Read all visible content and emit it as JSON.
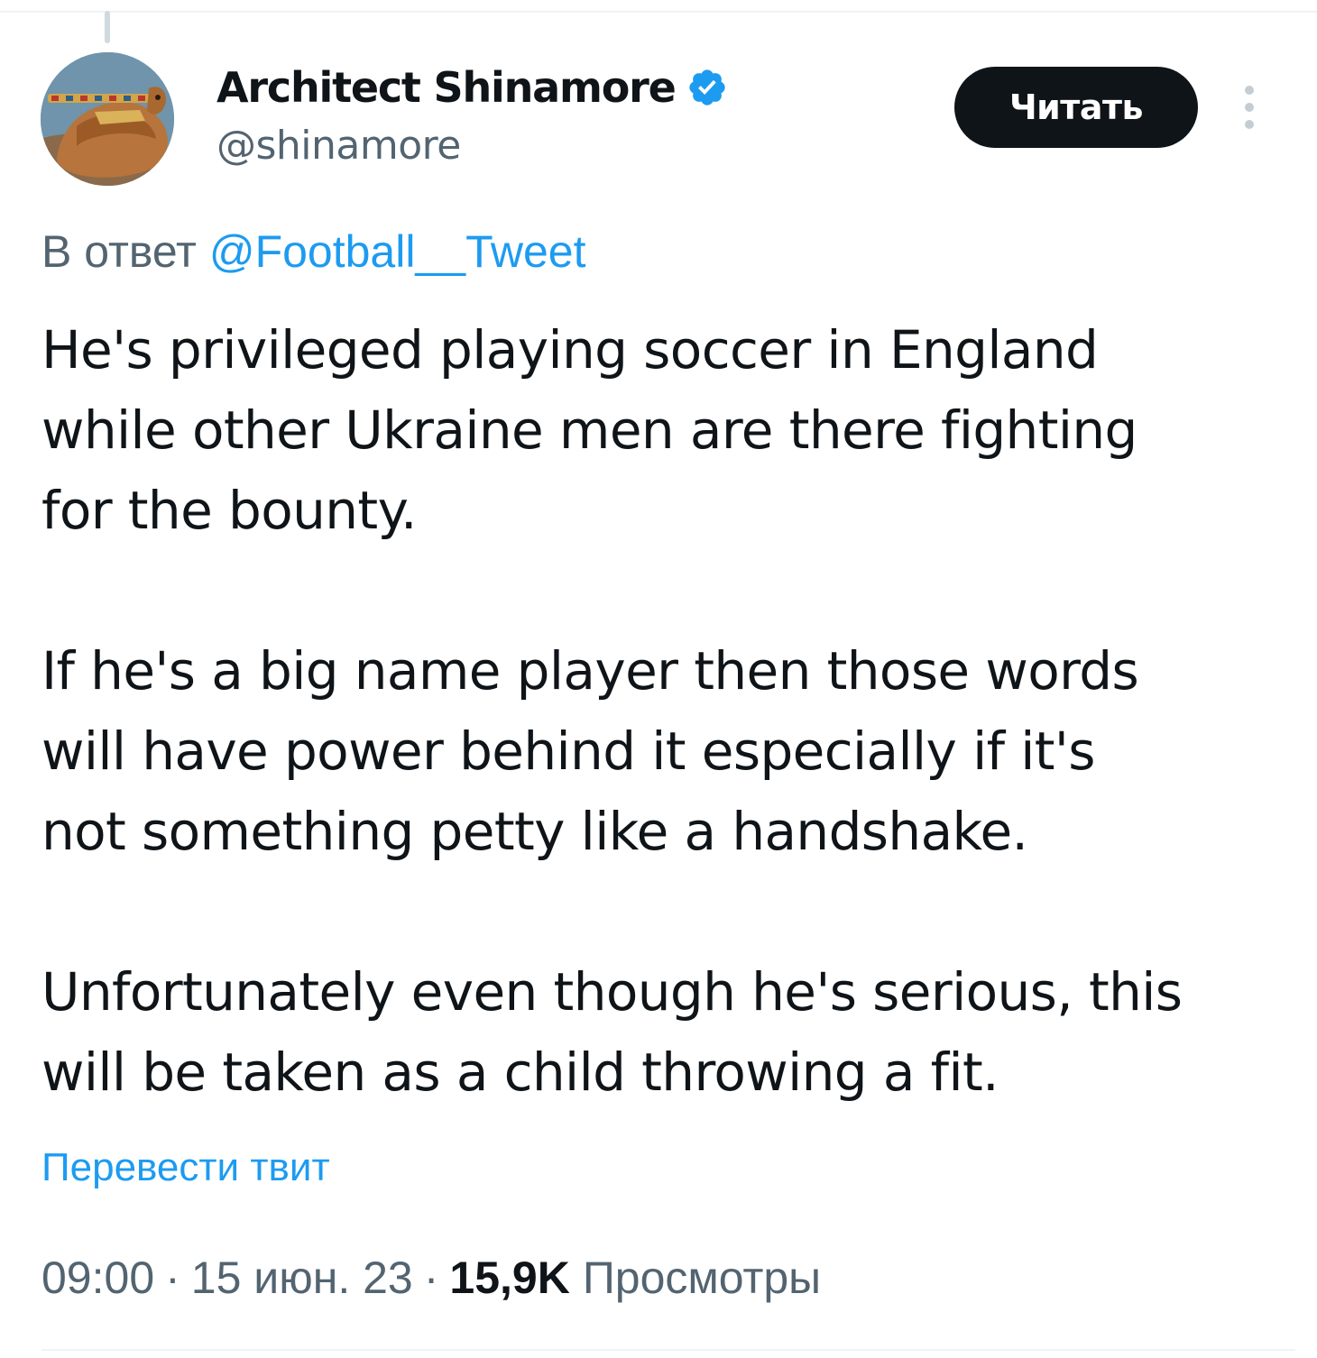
{
  "author": {
    "display_name": "Architect Shinamore",
    "handle": "@shinamore",
    "verified": true
  },
  "follow_button_label": "Читать",
  "reply_to": {
    "prefix": "В ответ",
    "mention": "@Football__Tweet"
  },
  "tweet": {
    "paragraphs": [
      "He's privileged playing soccer in England\nwhile other Ukraine men are there fighting\nfor the bounty.",
      "If he's a big name player then those words\nwill have power behind it especially if it's\nnot something petty like a handshake.",
      "Unfortunately even though he's serious, this\nwill be taken as a child throwing a fit."
    ]
  },
  "translate_label": "Перевести твит",
  "meta": {
    "time": "09:00",
    "separator": "·",
    "date": "15 июн. 23",
    "views_count": "15,9K",
    "views_label": "Просмотры"
  },
  "colors": {
    "text_primary": "#0f1419",
    "text_secondary": "#536471",
    "accent": "#1d9bf0",
    "button_bg": "#0f1419",
    "button_text": "#ffffff",
    "divider": "#eff3f4"
  },
  "icons": {
    "verified": "verified-badge-icon",
    "more": "more-vertical-icon"
  }
}
